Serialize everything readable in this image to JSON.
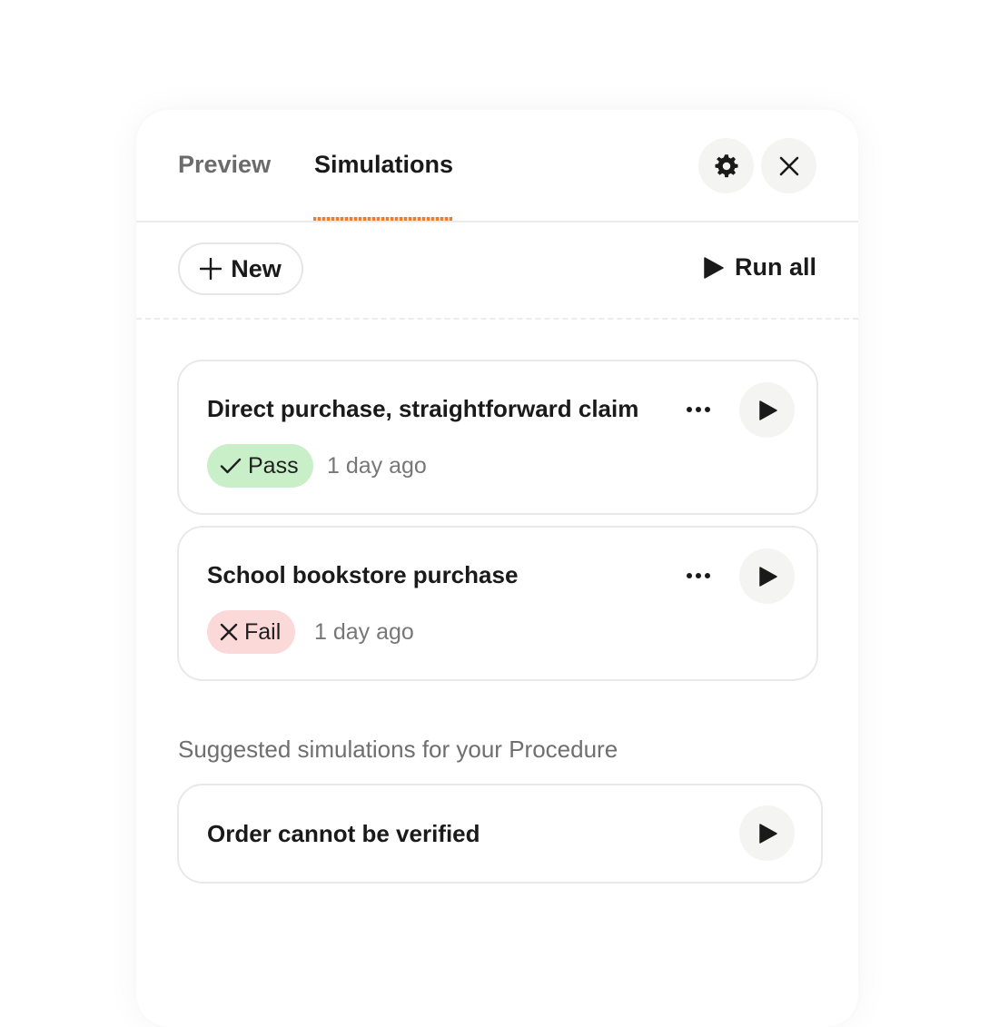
{
  "tabs": {
    "preview": "Preview",
    "simulations": "Simulations"
  },
  "header_icons": {
    "settings": "gear-icon",
    "close": "close-icon"
  },
  "toolbar": {
    "new_label": "New",
    "run_all_label": "Run all"
  },
  "simulations": [
    {
      "title": "Direct purchase, straightforward claim",
      "status": "Pass",
      "timestamp": "1 day ago"
    },
    {
      "title": "School bookstore purchase",
      "status": "Fail",
      "timestamp": "1 day ago"
    }
  ],
  "suggested": {
    "heading": "Suggested simulations for your Procedure",
    "items": [
      {
        "title": "Order cannot be verified"
      }
    ]
  },
  "colors": {
    "accent": "#f07a2f",
    "pass_bg": "#c9efc9",
    "fail_bg": "#fbd9d9"
  }
}
